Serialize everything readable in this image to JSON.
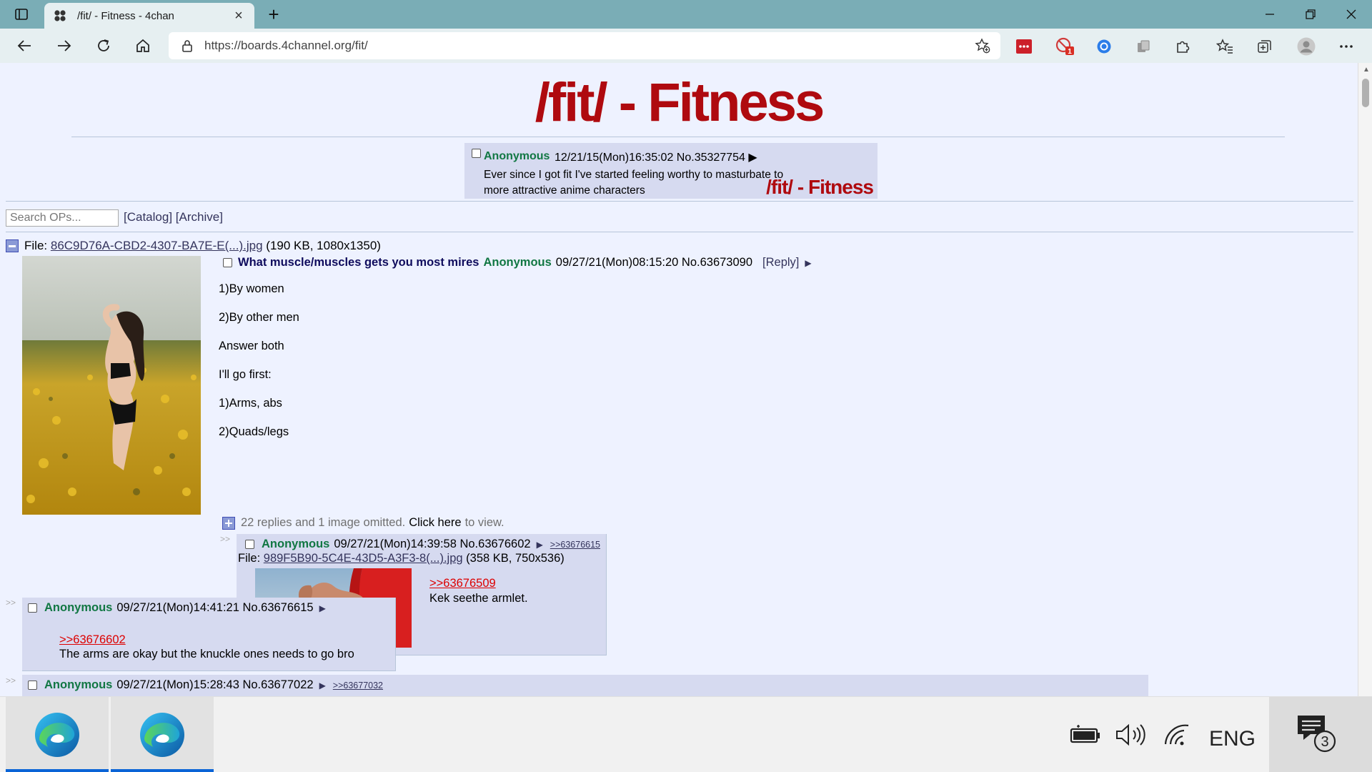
{
  "browser": {
    "tab_title": "/fit/ - Fitness - 4chan",
    "tab_close": "×",
    "new_tab": "+",
    "url": "https://boards.4channel.org/fit/",
    "ext_badge": "1"
  },
  "page": {
    "board_title": "/fit/ - Fitness",
    "banner": {
      "name": "Anonymous",
      "meta": "12/21/15(Mon)16:35:02 No.35327754 ▶",
      "message": "Ever since I got fit I've started feeling worthy to masturbate to more attractive anime characters",
      "watermark": "/fit/ - Fitness"
    },
    "search_placeholder": "Search OPs...",
    "catalog": "[Catalog]",
    "archive": "[Archive]",
    "op": {
      "file_label": "File:",
      "file_name": "86C9D76A-CBD2-4307-BA7E-E(...).jpg",
      "file_info": "(190 KB, 1080x1350)",
      "subject": "What muscle/muscles gets you most mires",
      "name": "Anonymous",
      "meta": "09/27/21(Mon)08:15:20 No.63673090",
      "reply": "[Reply]",
      "arrow": "▶",
      "lines": [
        "1)By women",
        "2)By other men",
        "Answer both",
        "I'll go first:",
        "1)Arms, abs",
        "2)Quads/legs"
      ],
      "omitted_prefix": "22 replies and 1 image omitted.",
      "omitted_link": "Click here",
      "omitted_suffix": "to view."
    },
    "replies": [
      {
        "name": "Anonymous",
        "meta": "09/27/21(Mon)14:39:58 No.63676602",
        "arrow": "▶",
        "backlink": ">>63676615",
        "file_label": "File:",
        "file_name": "989F5B90-5C4E-43D5-A3F3-8(...).jpg",
        "file_info": "(358 KB, 750x536)",
        "quote": ">>63676509",
        "text": "Kek seethe armlet."
      },
      {
        "name": "Anonymous",
        "meta": "09/27/21(Mon)14:41:21 No.63676615",
        "arrow": "▶",
        "quote": ">>63676602",
        "text": "The arms are okay but the knuckle ones needs to go bro"
      },
      {
        "name": "Anonymous",
        "meta": "09/27/21(Mon)15:28:43 No.63677022",
        "arrow": "▶",
        "backlink": ">>63677032"
      }
    ],
    "side_arrow": ">>"
  },
  "taskbar": {
    "language": "ENG",
    "notification_count": "3"
  },
  "colors": {
    "tabbar": "#7aadb6",
    "board_title": "#af0a0f",
    "name_green": "#117743",
    "subject_blue": "#0f0c5d",
    "post_bg": "#d6daf0",
    "page_bg": "#eef2ff",
    "quote_red": "#dd0000"
  }
}
